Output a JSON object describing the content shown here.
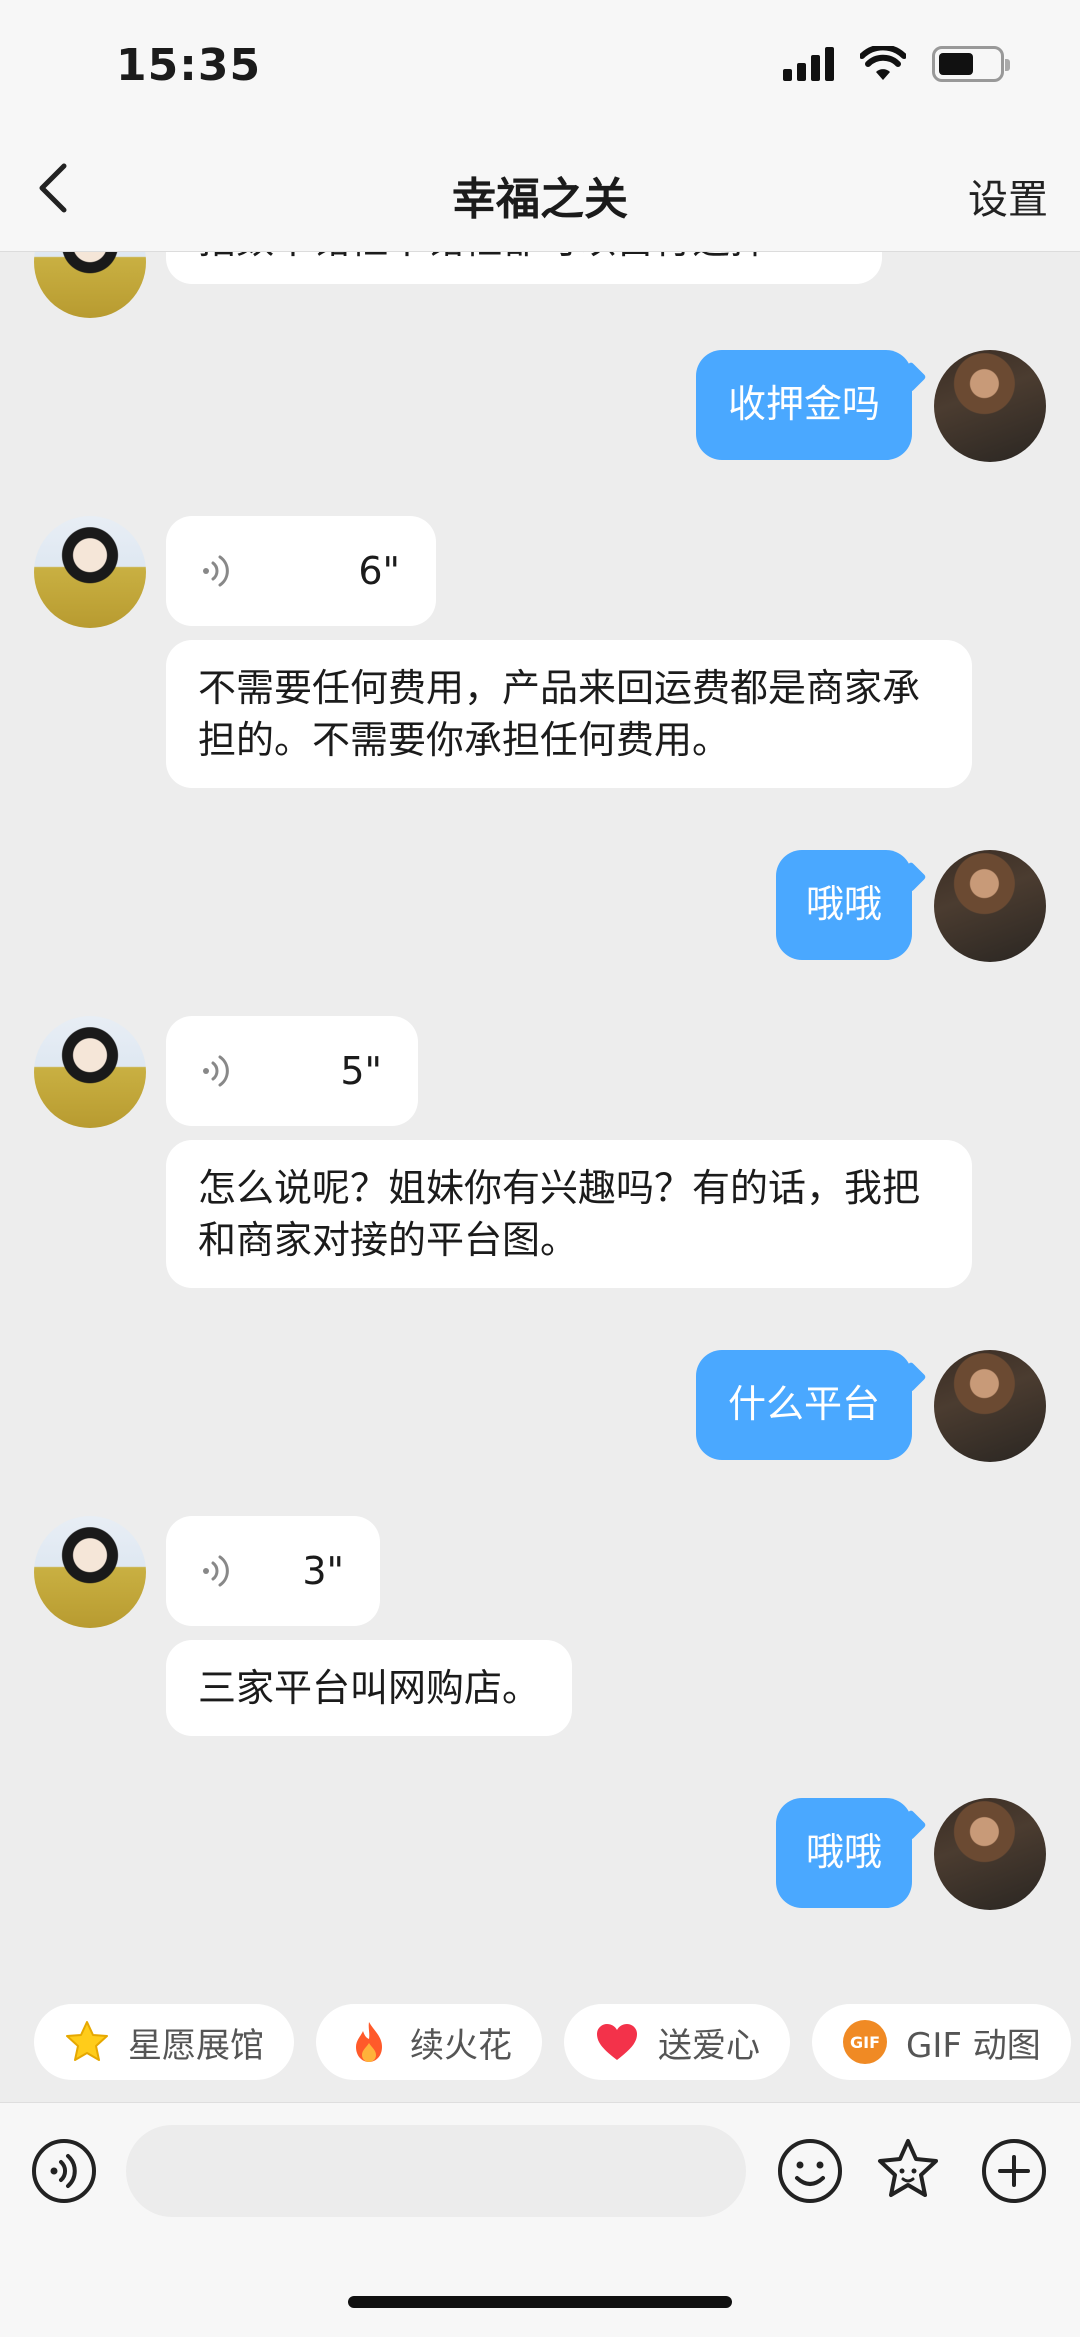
{
  "status_bar": {
    "time": "15:35"
  },
  "nav": {
    "title": "幸福之关",
    "settings_label": "设置"
  },
  "messages": [
    {
      "from": "them",
      "type": "text",
      "text": "指数不锗框不锗框都可以自行选择"
    },
    {
      "from": "me",
      "type": "text",
      "text": "收押金吗"
    },
    {
      "from": "them",
      "type": "voice",
      "duration": "6\""
    },
    {
      "from": "them",
      "type": "text",
      "text": "不需要任何费用，产品来回运费都是商家承担的。不需要你承担任何费用。"
    },
    {
      "from": "me",
      "type": "text",
      "text": "哦哦"
    },
    {
      "from": "them",
      "type": "voice",
      "duration": "5\""
    },
    {
      "from": "them",
      "type": "text",
      "text": "怎么说呢？姐妹你有兴趣吗？有的话，我把和商家对接的平台图。"
    },
    {
      "from": "me",
      "type": "text",
      "text": "什么平台"
    },
    {
      "from": "them",
      "type": "voice",
      "duration": "3\""
    },
    {
      "from": "them",
      "type": "text",
      "text": "三家平台叫网购店。"
    },
    {
      "from": "me",
      "type": "text",
      "text": "哦哦"
    }
  ],
  "quick_actions": [
    {
      "label": "星愿展馆",
      "icon": "star-icon"
    },
    {
      "label": "续火花",
      "icon": "fire-icon"
    },
    {
      "label": "送爱心",
      "icon": "heart-icon"
    },
    {
      "label": "GIF 动图",
      "icon": "gif-icon",
      "badge": "GIF"
    }
  ],
  "input": {
    "placeholder": ""
  },
  "colors": {
    "outgoing_bubble": "#4aa8ff",
    "incoming_bubble": "#ffffff",
    "background": "#ededed"
  }
}
